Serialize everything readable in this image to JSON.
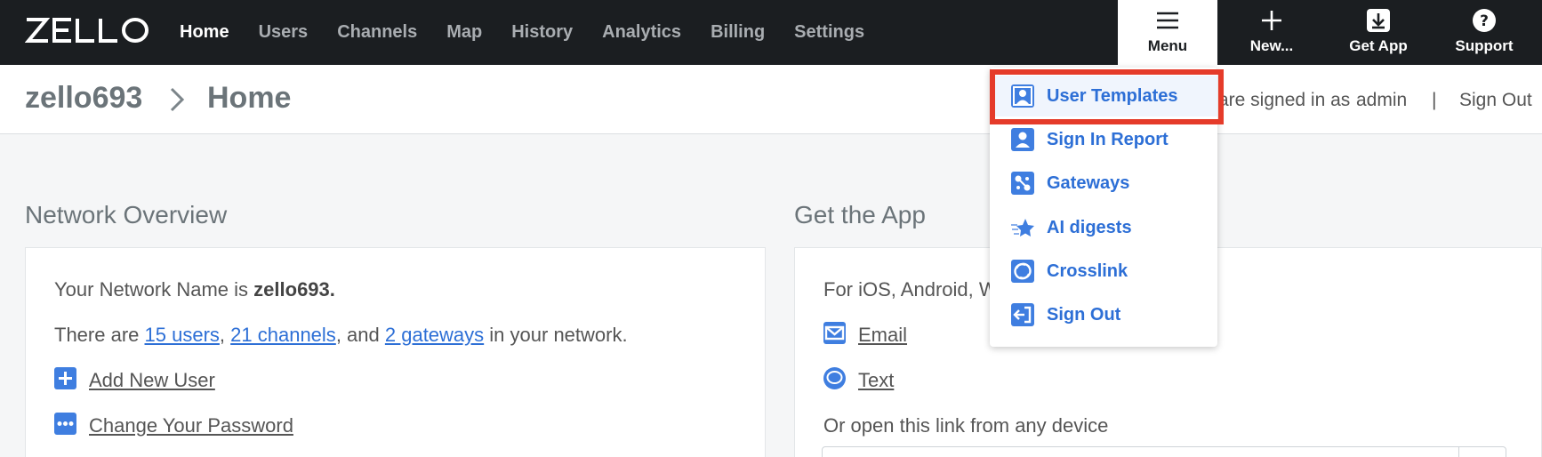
{
  "brand": {
    "logo_text": "ZELLO"
  },
  "nav": {
    "items": [
      {
        "label": "Home",
        "active": true
      },
      {
        "label": "Users",
        "active": false
      },
      {
        "label": "Channels",
        "active": false
      },
      {
        "label": "Map",
        "active": false
      },
      {
        "label": "History",
        "active": false
      },
      {
        "label": "Analytics",
        "active": false
      },
      {
        "label": "Billing",
        "active": false
      },
      {
        "label": "Settings",
        "active": false
      }
    ]
  },
  "toolbar": {
    "menu_label": "Menu",
    "new_label": "New...",
    "get_app_label": "Get App",
    "support_label": "Support"
  },
  "breadcrumb": {
    "network": "zello693",
    "page": "Home"
  },
  "session": {
    "signed_in_prefix": "are signed in as",
    "username": "admin",
    "separator": "|",
    "sign_out": "Sign Out"
  },
  "menu": {
    "items": [
      {
        "label": "User Templates",
        "icon": "user-template-icon",
        "highlighted": true
      },
      {
        "label": "Sign In Report",
        "icon": "user-report-icon"
      },
      {
        "label": "Gateways",
        "icon": "gateway-icon"
      },
      {
        "label": "AI digests",
        "icon": "sparkle-star-icon"
      },
      {
        "label": "Crosslink",
        "icon": "crosslink-icon"
      },
      {
        "label": "Sign Out",
        "icon": "sign-out-icon"
      }
    ]
  },
  "overview": {
    "title": "Network Overview",
    "name_prefix": "Your Network Name is",
    "name_value": "zello693.",
    "count_prefix": "There are",
    "users_link": "15 users",
    "comma1": ",",
    "channels_link": "21 channels",
    "and_text": ", and",
    "gateways_link": "2 gateways",
    "count_suffix": "in your network.",
    "add_user": "Add New User",
    "change_password": "Change Your Password"
  },
  "get_app": {
    "title": "Get the App",
    "platforms": "For iOS, Android, W",
    "email": "Email",
    "text": "Text",
    "open_link": "Or open this link from any device"
  },
  "colors": {
    "accent": "#2d6fd6",
    "nav_bg": "#1b1e21",
    "highlight_border": "#e53b2a"
  }
}
